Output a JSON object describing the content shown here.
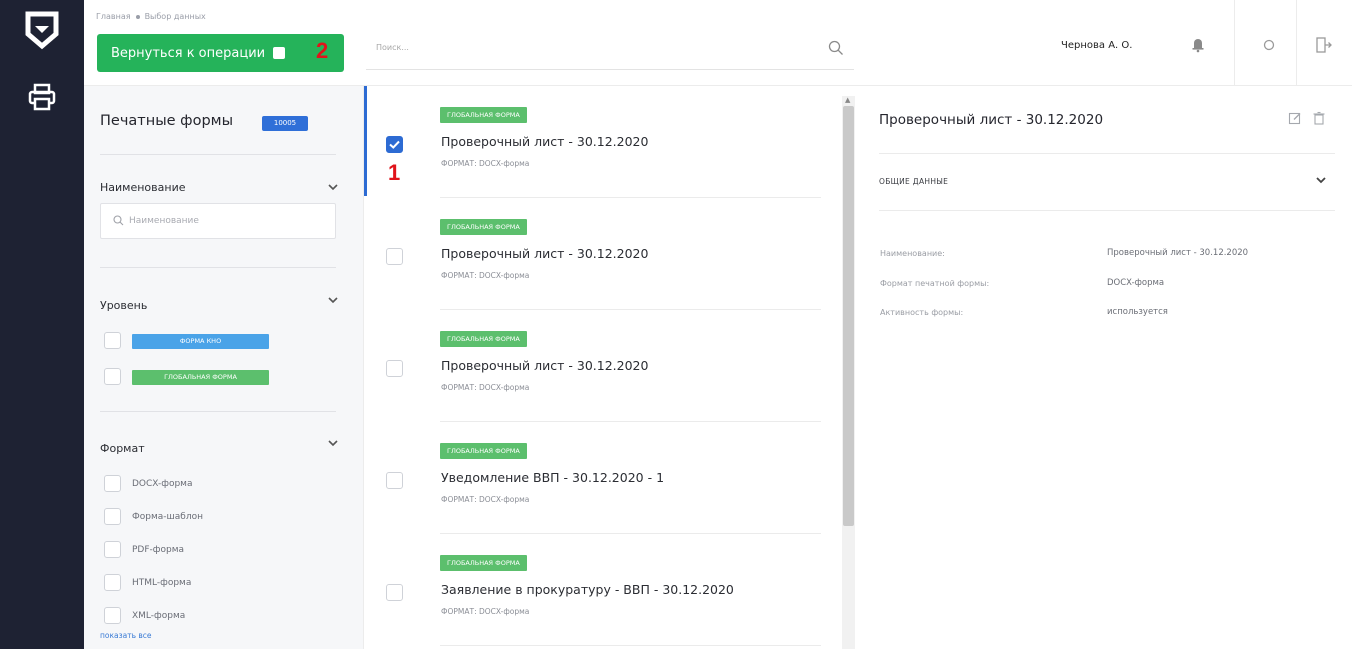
{
  "breadcrumb": [
    "Главная",
    "Выбор данных"
  ],
  "back_button": {
    "label": "Вернуться к операции"
  },
  "annotations": {
    "one": "1",
    "two": "2"
  },
  "search": {
    "placeholder": "Поиск..."
  },
  "user": {
    "name": "Чернова А. О."
  },
  "filters": {
    "title": "Печатные формы",
    "count_badge": "10005",
    "name_section": {
      "label": "Наименование",
      "placeholder": "Наименование"
    },
    "level_section": {
      "label": "Уровень",
      "tags": [
        "ФОРМА КНО",
        "ГЛОБАЛЬНАЯ ФОРМА"
      ]
    },
    "format_section": {
      "label": "Формат",
      "items": [
        "DOCX-форма",
        "Форма-шаблон",
        "PDF-форма",
        "HTML-форма",
        "XML-форма"
      ],
      "show_all": "показать все"
    }
  },
  "list": {
    "items": [
      {
        "tag": "ГЛОБАЛЬНАЯ ФОРМА",
        "title": "Проверочный лист - 30.12.2020",
        "format": "ФОРМАТ: DOCX-форма",
        "checked": true
      },
      {
        "tag": "ГЛОБАЛЬНАЯ ФОРМА",
        "title": "Проверочный лист - 30.12.2020",
        "format": "ФОРМАТ: DOCX-форма",
        "checked": false
      },
      {
        "tag": "ГЛОБАЛЬНАЯ ФОРМА",
        "title": "Проверочный лист - 30.12.2020",
        "format": "ФОРМАТ: DOCX-форма",
        "checked": false
      },
      {
        "tag": "ГЛОБАЛЬНАЯ ФОРМА",
        "title": "Уведомление ВВП - 30.12.2020 - 1",
        "format": "ФОРМАТ: DOCX-форма",
        "checked": false
      },
      {
        "tag": "ГЛОБАЛЬНАЯ ФОРМА",
        "title": "Заявление в прокуратуру - ВВП - 30.12.2020",
        "format": "ФОРМАТ: DOCX-форма",
        "checked": false
      }
    ]
  },
  "details": {
    "title": "Проверочный лист - 30.12.2020",
    "section": "ОБЩИЕ ДАННЫЕ",
    "fields": [
      {
        "key": "Наименование:",
        "value": "Проверочный лист - 30.12.2020"
      },
      {
        "key": "Формат печатной формы:",
        "value": "DOCX-форма"
      },
      {
        "key": "Активность формы:",
        "value": "используется"
      }
    ]
  },
  "colors": {
    "accent_green": "#25b35a",
    "accent_blue": "#2d6bd3",
    "rail": "#1e2233",
    "tag_green": "#5cbf6d",
    "tag_blue": "#4aa3e8",
    "annotation_red": "#e0141b"
  },
  "icons": [
    "shield-logo-icon",
    "printer-icon",
    "search-icon",
    "bell-icon",
    "settings-icon",
    "logout-icon",
    "chevron-down-icon",
    "edit-icon",
    "trash-icon",
    "check-icon"
  ]
}
